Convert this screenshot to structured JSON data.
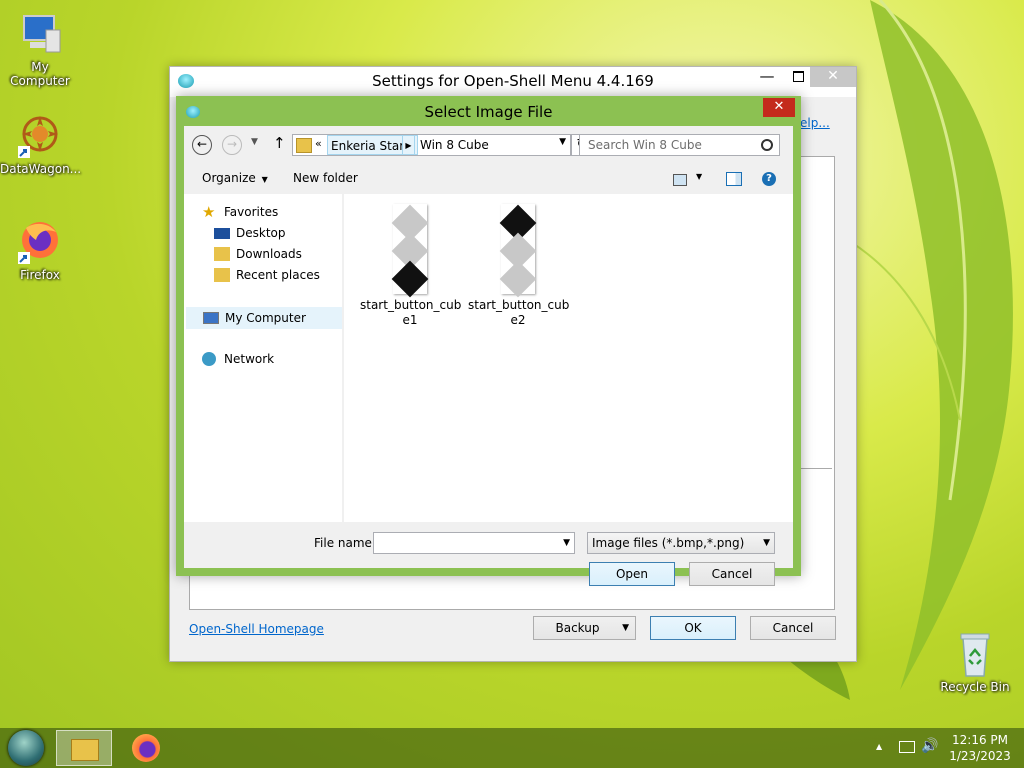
{
  "desktop": {
    "icons": [
      {
        "label": "My Computer",
        "icon": "computer-icon"
      },
      {
        "label": "DataWagon...",
        "icon": "datawagon-icon"
      },
      {
        "label": "Firefox",
        "icon": "firefox-icon"
      },
      {
        "label": "Recycle Bin",
        "icon": "recycle-bin-icon"
      }
    ]
  },
  "settings_window": {
    "title": "Settings for Open-Shell Menu 4.4.169",
    "help_link_partial": "elp...",
    "homepage_link": "Open-Shell Homepage",
    "backup_label": "Backup",
    "ok_label": "OK",
    "cancel_label": "Cancel"
  },
  "file_dialog": {
    "title": "Select Image File",
    "breadcrumb": {
      "overflow": "«",
      "parent": "Enkeria Star...",
      "current": "Win 8 Cube"
    },
    "search_placeholder": "Search Win 8 Cube",
    "toolbar": {
      "organize_label": "Organize",
      "new_folder_label": "New folder"
    },
    "nav": {
      "favorites_label": "Favorites",
      "favorites": [
        "Desktop",
        "Downloads",
        "Recent places"
      ],
      "my_computer_label": "My Computer",
      "network_label": "Network"
    },
    "files": [
      {
        "name_line1": "start_button_cub",
        "name_line2": "e1"
      },
      {
        "name_line1": "start_button_cub",
        "name_line2": "e2"
      }
    ],
    "file_name_label": "File name:",
    "file_name_value": "",
    "file_type_value": "Image files (*.bmp,*.png)",
    "open_label": "Open",
    "cancel_label": "Cancel"
  },
  "taskbar": {
    "time": "12:16 PM",
    "date": "1/23/2023"
  },
  "colors": {
    "dialog_frame": "#8cc152",
    "accent_blue": "#3c7fb1",
    "close_red": "#c42b1c"
  }
}
